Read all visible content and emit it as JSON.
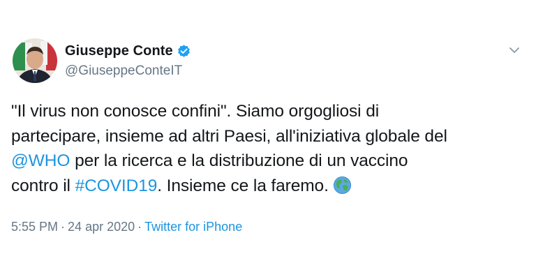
{
  "author": {
    "display_name": "Giuseppe Conte",
    "handle": "@GiuseppeConteIT",
    "verified": true
  },
  "tweet": {
    "line1": "\"Il virus non conosce confini\". Siamo orgogliosi di",
    "line2": "partecipare, insieme ad altri Paesi, all'iniziativa globale del",
    "line3_mention": "@WHO",
    "line3_rest": " per la ricerca e la distribuzione di un vaccino",
    "line4_start": "contro il ",
    "line4_hashtag": "#COVID19",
    "line4_rest": ". Insieme ce la faremo."
  },
  "meta": {
    "time": "5:55 PM",
    "separator": "·",
    "date": "24 apr 2020",
    "source": "Twitter for iPhone"
  },
  "icons": {
    "verified": "verified-badge-icon",
    "more": "chevron-down-icon",
    "emoji": "globe-icon"
  },
  "colors": {
    "link": "#1b95e0",
    "text": "#14171a",
    "secondary": "#657786"
  }
}
